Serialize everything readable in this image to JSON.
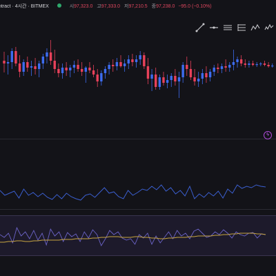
{
  "header": {
    "symbol": "ntract · 4시간 · BITMEX",
    "open_label": "시",
    "open_value": "97,323.0",
    "high_label": "고",
    "high_value": "97,333.0",
    "low_label": "저",
    "low_value": "97,210.5",
    "close_label": "종",
    "close_value": "97,238.0",
    "change": "−95.0 (−0.10%)"
  },
  "toolbar": {
    "tools": [
      "trend-line-icon",
      "horizontal-line-icon",
      "parallel-channel-icon",
      "fib-retracement-icon",
      "pattern-icon",
      "elliott-wave-icon"
    ]
  },
  "colors": {
    "up": "#3d6cf0",
    "down": "#e8415a",
    "momentum_line": "#3b5fd0",
    "rsi_line": "#6c64c8",
    "rsi_ma": "#c9a640",
    "alert": "#d062ff"
  },
  "candles": [
    {
      "o": 88,
      "h": 75,
      "l": 105,
      "c": 92
    },
    {
      "o": 92,
      "h": 80,
      "l": 108,
      "c": 90
    },
    {
      "o": 90,
      "h": 70,
      "l": 100,
      "c": 74
    },
    {
      "o": 74,
      "h": 68,
      "l": 96,
      "c": 92
    },
    {
      "o": 92,
      "h": 80,
      "l": 112,
      "c": 104
    },
    {
      "o": 104,
      "h": 86,
      "l": 110,
      "c": 90
    },
    {
      "o": 90,
      "h": 82,
      "l": 104,
      "c": 98
    },
    {
      "o": 98,
      "h": 88,
      "l": 110,
      "c": 96
    },
    {
      "o": 96,
      "h": 84,
      "l": 108,
      "c": 100
    },
    {
      "o": 100,
      "h": 88,
      "l": 112,
      "c": 92
    },
    {
      "o": 92,
      "h": 78,
      "l": 100,
      "c": 82
    },
    {
      "o": 82,
      "h": 70,
      "l": 92,
      "c": 76
    },
    {
      "o": 76,
      "h": 58,
      "l": 94,
      "c": 88
    },
    {
      "o": 88,
      "h": 72,
      "l": 106,
      "c": 100
    },
    {
      "o": 100,
      "h": 92,
      "l": 112,
      "c": 106
    },
    {
      "o": 106,
      "h": 92,
      "l": 114,
      "c": 98
    },
    {
      "o": 98,
      "h": 90,
      "l": 110,
      "c": 102
    },
    {
      "o": 102,
      "h": 94,
      "l": 112,
      "c": 98
    },
    {
      "o": 98,
      "h": 88,
      "l": 106,
      "c": 94
    },
    {
      "o": 94,
      "h": 86,
      "l": 104,
      "c": 100
    },
    {
      "o": 100,
      "h": 90,
      "l": 110,
      "c": 104
    },
    {
      "o": 104,
      "h": 96,
      "l": 120,
      "c": 98
    },
    {
      "o": 98,
      "h": 90,
      "l": 106,
      "c": 102
    },
    {
      "o": 102,
      "h": 94,
      "l": 112,
      "c": 108
    },
    {
      "o": 108,
      "h": 100,
      "l": 126,
      "c": 118
    },
    {
      "o": 118,
      "h": 102,
      "l": 124,
      "c": 106
    },
    {
      "o": 106,
      "h": 96,
      "l": 114,
      "c": 100
    },
    {
      "o": 100,
      "h": 90,
      "l": 108,
      "c": 94
    },
    {
      "o": 94,
      "h": 86,
      "l": 104,
      "c": 96
    },
    {
      "o": 96,
      "h": 84,
      "l": 102,
      "c": 90
    },
    {
      "o": 90,
      "h": 80,
      "l": 98,
      "c": 96
    },
    {
      "o": 96,
      "h": 86,
      "l": 104,
      "c": 92
    },
    {
      "o": 92,
      "h": 80,
      "l": 100,
      "c": 86
    },
    {
      "o": 86,
      "h": 78,
      "l": 96,
      "c": 90
    },
    {
      "o": 90,
      "h": 80,
      "l": 98,
      "c": 86
    },
    {
      "o": 86,
      "h": 74,
      "l": 94,
      "c": 80
    },
    {
      "o": 80,
      "h": 76,
      "l": 100,
      "c": 96
    },
    {
      "o": 96,
      "h": 84,
      "l": 122,
      "c": 114
    },
    {
      "o": 114,
      "h": 100,
      "l": 132,
      "c": 108
    },
    {
      "o": 108,
      "h": 98,
      "l": 130,
      "c": 126
    },
    {
      "o": 126,
      "h": 108,
      "l": 130,
      "c": 112
    },
    {
      "o": 112,
      "h": 104,
      "l": 124,
      "c": 120
    },
    {
      "o": 120,
      "h": 108,
      "l": 128,
      "c": 116
    },
    {
      "o": 116,
      "h": 106,
      "l": 126,
      "c": 110
    },
    {
      "o": 110,
      "h": 100,
      "l": 124,
      "c": 118
    },
    {
      "o": 118,
      "h": 104,
      "l": 142,
      "c": 112
    },
    {
      "o": 112,
      "h": 90,
      "l": 120,
      "c": 94
    },
    {
      "o": 94,
      "h": 82,
      "l": 110,
      "c": 100
    },
    {
      "o": 100,
      "h": 88,
      "l": 116,
      "c": 112
    },
    {
      "o": 112,
      "h": 100,
      "l": 124,
      "c": 118
    },
    {
      "o": 118,
      "h": 104,
      "l": 126,
      "c": 114
    },
    {
      "o": 114,
      "h": 100,
      "l": 122,
      "c": 106
    },
    {
      "o": 106,
      "h": 96,
      "l": 120,
      "c": 112
    },
    {
      "o": 112,
      "h": 100,
      "l": 118,
      "c": 104
    },
    {
      "o": 104,
      "h": 94,
      "l": 110,
      "c": 98
    },
    {
      "o": 98,
      "h": 92,
      "l": 106,
      "c": 100
    },
    {
      "o": 100,
      "h": 92,
      "l": 106,
      "c": 96
    },
    {
      "o": 96,
      "h": 86,
      "l": 104,
      "c": 98
    },
    {
      "o": 98,
      "h": 90,
      "l": 104,
      "c": 94
    },
    {
      "o": 94,
      "h": 72,
      "l": 102,
      "c": 90
    },
    {
      "o": 90,
      "h": 82,
      "l": 98,
      "c": 86
    },
    {
      "o": 86,
      "h": 80,
      "l": 96,
      "c": 92
    },
    {
      "o": 92,
      "h": 86,
      "l": 98,
      "c": 94
    },
    {
      "o": 94,
      "h": 88,
      "l": 98,
      "c": 92
    },
    {
      "o": 92,
      "h": 88,
      "l": 96,
      "c": 94
    },
    {
      "o": 94,
      "h": 90,
      "l": 97,
      "c": 93
    },
    {
      "o": 93,
      "h": 90,
      "l": 96,
      "c": 92
    },
    {
      "o": 92,
      "h": 88,
      "l": 96,
      "c": 94
    },
    {
      "o": 94,
      "h": 90,
      "l": 98,
      "c": 96
    },
    {
      "o": 96,
      "h": 92,
      "l": 98,
      "c": 95
    }
  ],
  "momentum": [
    276,
    283,
    280,
    277,
    287,
    274,
    283,
    279,
    285,
    280,
    286,
    289,
    282,
    288,
    280,
    285,
    288,
    290,
    283,
    281,
    286,
    279,
    272,
    280,
    278,
    285,
    288,
    276,
    283,
    279,
    274,
    276,
    270,
    275,
    268,
    277,
    272,
    281,
    276,
    284,
    270,
    288,
    281,
    286,
    279,
    284,
    277,
    287,
    274,
    280,
    268,
    273,
    270,
    272,
    268,
    270,
    271
  ],
  "rsi": [
    340,
    344,
    338,
    352,
    330,
    342,
    336,
    346,
    334,
    348,
    338,
    355,
    332,
    342,
    336,
    350,
    337,
    343,
    339,
    350,
    336,
    345,
    333,
    340,
    356,
    346,
    334,
    340,
    336,
    345,
    348,
    346,
    354,
    340,
    345,
    338,
    354,
    342,
    352,
    344,
    336,
    346,
    334,
    342,
    338,
    346,
    335,
    332,
    338,
    344,
    342,
    336,
    340,
    333,
    338,
    345,
    336,
    340,
    342,
    338,
    337,
    345,
    339,
    340
  ],
  "rsi_ma": [
    351,
    351,
    350,
    350,
    349,
    349,
    350,
    350,
    349,
    349,
    348,
    348,
    348,
    348,
    348,
    347,
    347,
    347,
    346,
    346,
    346,
    346,
    345,
    345,
    344,
    344,
    343,
    343,
    343,
    344,
    344,
    344,
    343,
    343,
    344,
    344,
    345,
    345,
    346,
    346,
    345,
    345,
    344,
    344,
    344,
    343,
    343,
    342,
    342,
    342,
    342,
    341,
    341,
    340,
    340,
    339,
    339,
    338,
    338,
    338,
    338,
    339,
    339,
    340
  ]
}
